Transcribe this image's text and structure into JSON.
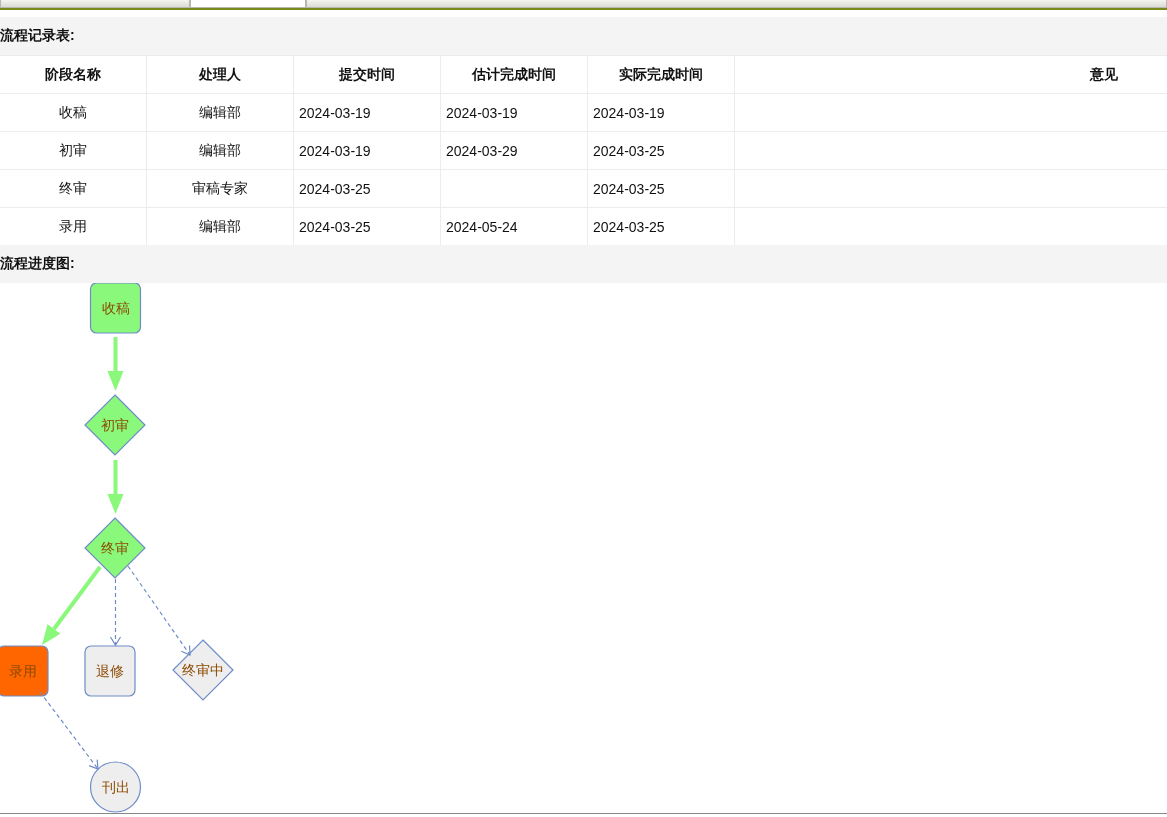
{
  "tabs": [
    {
      "selected": false
    },
    {
      "selected": true
    },
    {
      "selected": false
    }
  ],
  "record_section": {
    "title": "流程记录表:"
  },
  "table": {
    "columns": [
      "阶段名称",
      "处理人",
      "提交时间",
      "估计完成时间",
      "实际完成时间",
      "意见"
    ],
    "rows": [
      {
        "stage": "收稿",
        "handler": "编辑部",
        "submitted": "2024-03-19",
        "estimated": "2024-03-19",
        "actual": "2024-03-19"
      },
      {
        "stage": "初审",
        "handler": "编辑部",
        "submitted": "2024-03-19",
        "estimated": "2024-03-29",
        "actual": "2024-03-25"
      },
      {
        "stage": "终审",
        "handler": "审稿专家",
        "submitted": "2024-03-25",
        "actual": "2024-03-25"
      },
      {
        "stage": "录用",
        "handler": "编辑部",
        "submitted": "2024-03-25",
        "estimated": "2024-05-24",
        "actual": "2024-03-25"
      }
    ]
  },
  "diagram_section": {
    "title": "流程进度图:"
  },
  "diagram": {
    "nodes": [
      {
        "kind": "process",
        "label": "收稿",
        "color": "#8af87a"
      },
      {
        "kind": "decision",
        "label": "初审",
        "color": "#8af87a"
      },
      {
        "kind": "decision",
        "label": "终审",
        "color": "#8af87a"
      },
      {
        "kind": "process",
        "label": "录用",
        "color": "#ff6600"
      },
      {
        "kind": "process",
        "label": "退修",
        "color": "#eeeeee"
      },
      {
        "kind": "decision",
        "label": "终审中",
        "color": "#eeeeee"
      },
      {
        "kind": "terminal",
        "label": "刊出",
        "color": "#eeeeee"
      }
    ],
    "edges": [
      {
        "done": true
      },
      {
        "done": true
      },
      {
        "done": true
      },
      {
        "done": false
      },
      {
        "done": false
      },
      {
        "done": false
      }
    ]
  }
}
